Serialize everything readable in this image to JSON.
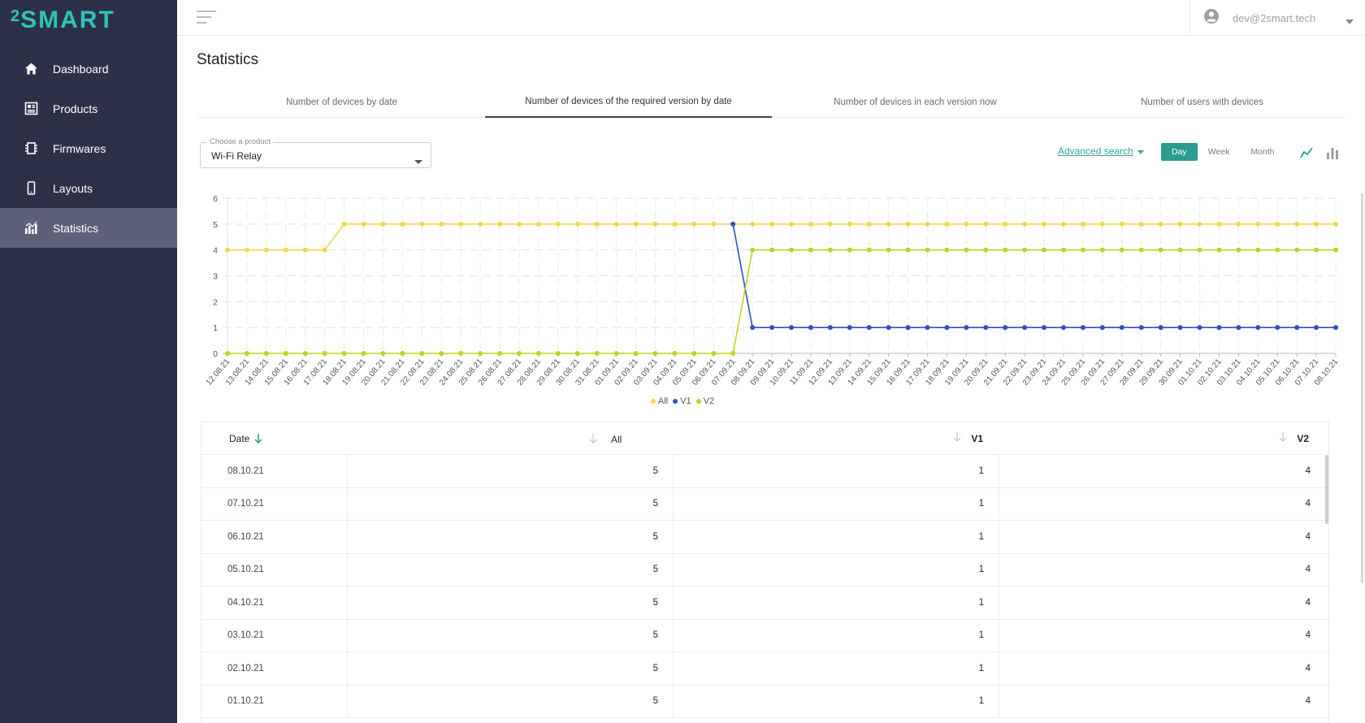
{
  "app": {
    "logo_sup": "2",
    "logo_word": "SMART"
  },
  "sidebar": {
    "items": [
      {
        "label": "Dashboard",
        "icon": "home-icon"
      },
      {
        "label": "Products",
        "icon": "products-icon"
      },
      {
        "label": "Firmwares",
        "icon": "firmware-icon"
      },
      {
        "label": "Layouts",
        "icon": "phone-icon"
      },
      {
        "label": "Statistics",
        "icon": "statistics-icon",
        "active": true
      }
    ]
  },
  "topbar": {
    "user_email": "dev@2smart.tech"
  },
  "page": {
    "title": "Statistics"
  },
  "tabs": [
    {
      "label": "Number of devices by date"
    },
    {
      "label": "Number of devices of the required version by date",
      "active": true
    },
    {
      "label": "Number of devices in each version now"
    },
    {
      "label": "Number of users with devices"
    }
  ],
  "filters": {
    "product_label": "Choose a product",
    "product_value": "Wi-Fi Relay",
    "advanced_search": "Advanced search",
    "periods": [
      "Day",
      "Week",
      "Month"
    ],
    "active_period": "Day"
  },
  "colors": {
    "accent": "#2a9d8f",
    "sidebar": "#2c3147",
    "all": "#f2d64e",
    "v1": "#2d4fc4",
    "v2": "#c4cf27"
  },
  "chart_data": {
    "type": "line",
    "ylim": [
      0,
      6
    ],
    "yticks": [
      0,
      1,
      2,
      3,
      4,
      5,
      6
    ],
    "x": [
      "12.08.21",
      "13.08.21",
      "14.08.21",
      "15.08.21",
      "16.08.21",
      "17.08.21",
      "18.08.21",
      "19.08.21",
      "20.08.21",
      "21.08.21",
      "22.08.21",
      "23.08.21",
      "24.08.21",
      "25.08.21",
      "26.08.21",
      "27.08.21",
      "28.08.21",
      "29.08.21",
      "30.08.21",
      "31.08.21",
      "01.09.21",
      "02.09.21",
      "03.09.21",
      "04.09.21",
      "05.09.21",
      "06.09.21",
      "07.09.21",
      "08.09.21",
      "09.09.21",
      "10.09.21",
      "11.09.21",
      "12.09.21",
      "13.09.21",
      "14.09.21",
      "15.09.21",
      "16.09.21",
      "17.09.21",
      "18.09.21",
      "19.09.21",
      "20.09.21",
      "21.09.21",
      "22.09.21",
      "23.09.21",
      "24.09.21",
      "25.09.21",
      "26.09.21",
      "27.09.21",
      "28.09.21",
      "29.09.21",
      "30.09.21",
      "01.10.21",
      "02.10.21",
      "03.10.21",
      "04.10.21",
      "05.10.21",
      "06.10.21",
      "07.10.21",
      "08.10.21"
    ],
    "series": [
      {
        "name": "All",
        "color": "#f2d64e",
        "values": [
          4,
          4,
          4,
          4,
          4,
          4,
          5,
          5,
          5,
          5,
          5,
          5,
          5,
          5,
          5,
          5,
          5,
          5,
          5,
          5,
          5,
          5,
          5,
          5,
          5,
          5,
          5,
          5,
          5,
          5,
          5,
          5,
          5,
          5,
          5,
          5,
          5,
          5,
          5,
          5,
          5,
          5,
          5,
          5,
          5,
          5,
          5,
          5,
          5,
          5,
          5,
          5,
          5,
          5,
          5,
          5,
          5,
          5
        ]
      },
      {
        "name": "V1",
        "color": "#2d4fc4",
        "values": [
          null,
          null,
          null,
          null,
          null,
          null,
          null,
          null,
          null,
          null,
          null,
          null,
          null,
          null,
          null,
          null,
          null,
          null,
          null,
          null,
          null,
          null,
          null,
          null,
          null,
          null,
          5,
          1,
          1,
          1,
          1,
          1,
          1,
          1,
          1,
          1,
          1,
          1,
          1,
          1,
          1,
          1,
          1,
          1,
          1,
          1,
          1,
          1,
          1,
          1,
          1,
          1,
          1,
          1,
          1,
          1,
          1,
          1
        ]
      },
      {
        "name": "V2",
        "color": "#c4cf27",
        "values": [
          0,
          0,
          0,
          0,
          0,
          0,
          0,
          0,
          0,
          0,
          0,
          0,
          0,
          0,
          0,
          0,
          0,
          0,
          0,
          0,
          0,
          0,
          0,
          0,
          0,
          0,
          0,
          4,
          4,
          4,
          4,
          4,
          4,
          4,
          4,
          4,
          4,
          4,
          4,
          4,
          4,
          4,
          4,
          4,
          4,
          4,
          4,
          4,
          4,
          4,
          4,
          4,
          4,
          4,
          4,
          4,
          4,
          4
        ]
      }
    ],
    "legend": "bottom-center",
    "grid": true
  },
  "table": {
    "headers": {
      "date": "Date",
      "all": "All",
      "v1": "V1",
      "v2": "V2"
    },
    "rows": [
      {
        "date": "08.10.21",
        "all": "5",
        "v1": "1",
        "v2": "4"
      },
      {
        "date": "07.10.21",
        "all": "5",
        "v1": "1",
        "v2": "4"
      },
      {
        "date": "06.10.21",
        "all": "5",
        "v1": "1",
        "v2": "4"
      },
      {
        "date": "05.10.21",
        "all": "5",
        "v1": "1",
        "v2": "4"
      },
      {
        "date": "04.10.21",
        "all": "5",
        "v1": "1",
        "v2": "4"
      },
      {
        "date": "03.10.21",
        "all": "5",
        "v1": "1",
        "v2": "4"
      },
      {
        "date": "02.10.21",
        "all": "5",
        "v1": "1",
        "v2": "4"
      },
      {
        "date": "01.10.21",
        "all": "5",
        "v1": "1",
        "v2": "4"
      }
    ]
  }
}
